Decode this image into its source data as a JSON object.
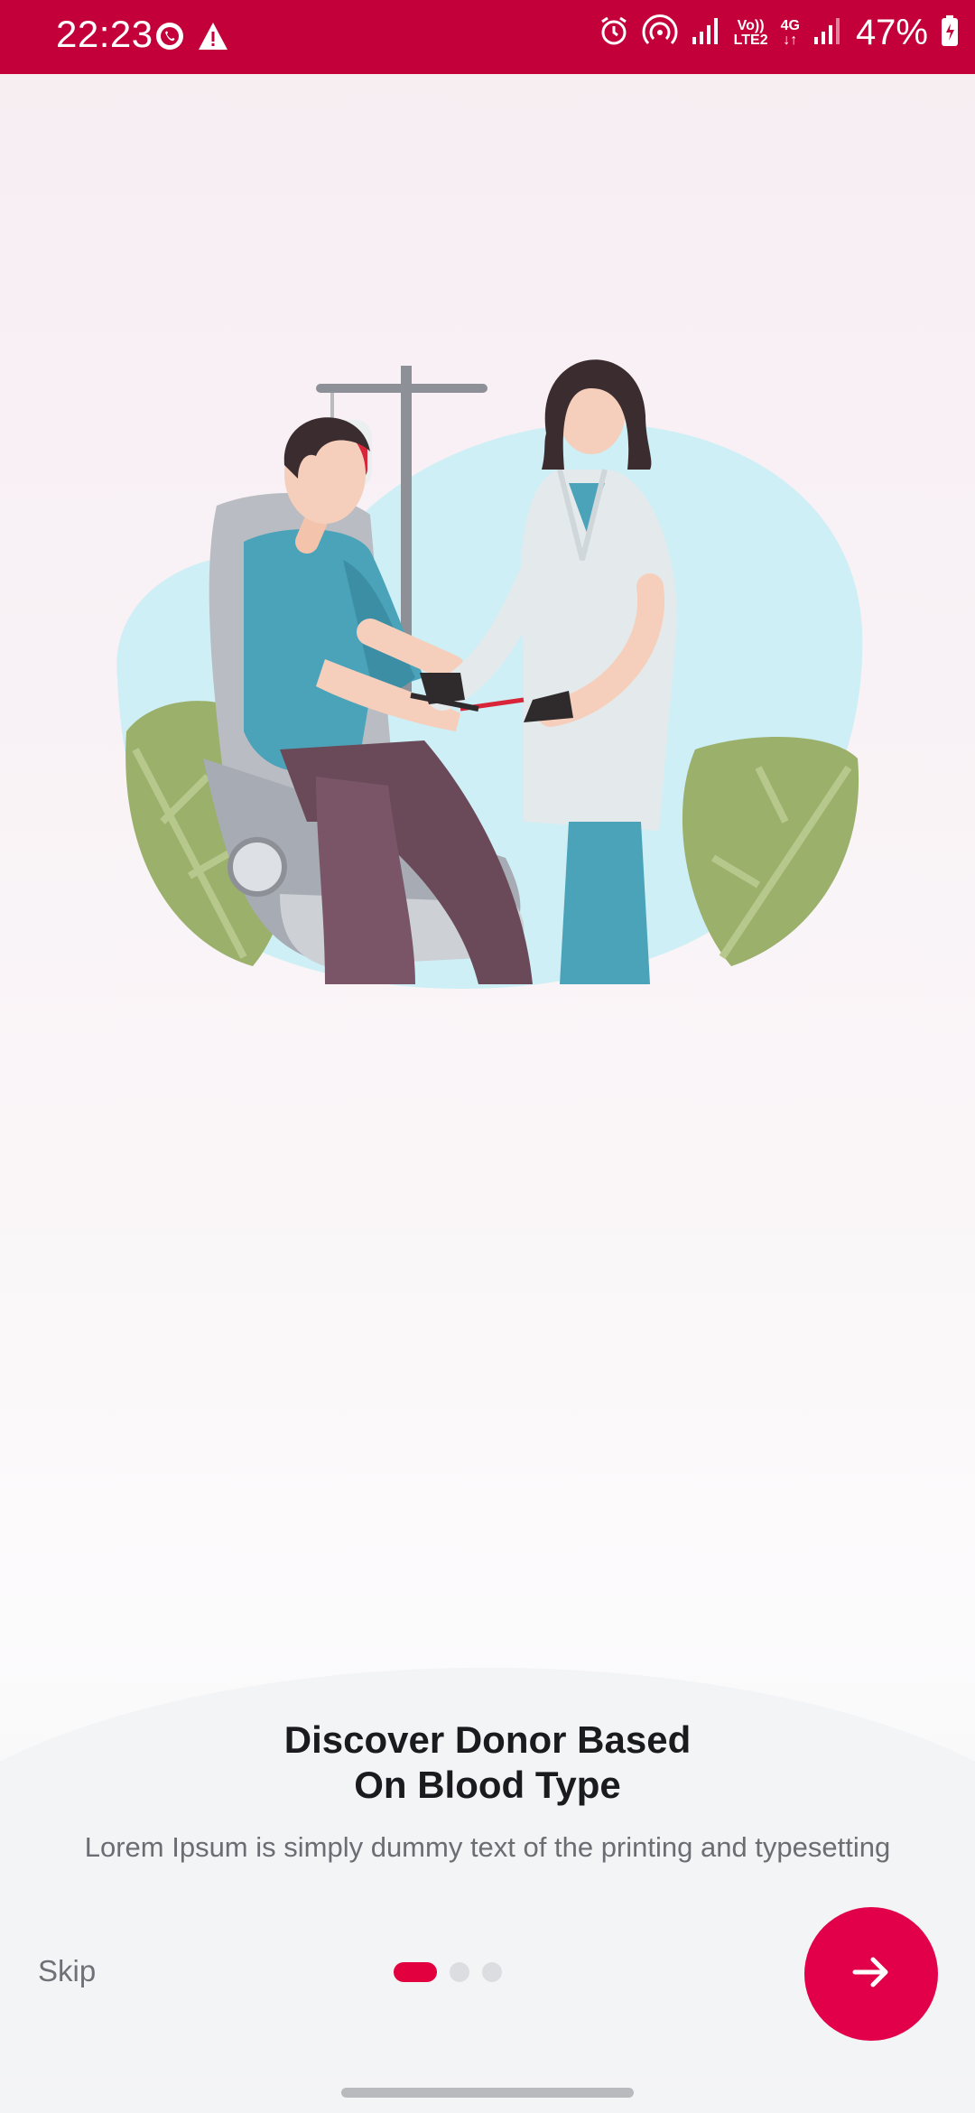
{
  "status_bar": {
    "time": "22:23",
    "network_top": "Vo))",
    "network_bottom": "LTE2",
    "data_type": "4G",
    "battery": "47%",
    "icons": [
      "whatsapp-icon",
      "warning-icon",
      "alarm-icon",
      "hotspot-icon",
      "signal-icon",
      "signal-icon",
      "battery-charging-icon"
    ]
  },
  "onboarding": {
    "title_line1": "Discover Donor Based",
    "title_line2": "On Blood Type",
    "subtitle": "Lorem Ipsum is simply dummy text of the printing and typesetting",
    "skip_label": "Skip",
    "page_count": 3,
    "current_page": 1,
    "next_icon": "arrow-right-icon"
  },
  "colors": {
    "brand": "#c4003a",
    "accent": "#e3004a"
  }
}
